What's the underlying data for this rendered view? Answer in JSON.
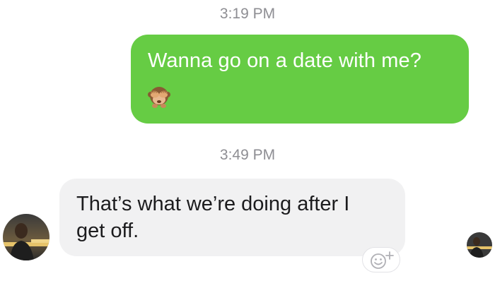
{
  "thread": {
    "timestamp_1": "3:19 PM",
    "timestamp_2": "3:49 PM"
  },
  "messages": [
    {
      "direction": "outgoing",
      "text": "Wanna go on a date with me?",
      "emoji": "see-no-evil-monkey-icon",
      "bubble_color": "#66cc44"
    },
    {
      "direction": "incoming",
      "text_line1": "That’s what we’re doing after I",
      "text_line2": "get off.",
      "bubble_color": "#f1f1f2"
    }
  ],
  "icons": {
    "reaction": "add-reaction-icon",
    "avatar_left": "contact-avatar",
    "avatar_right": "read-receipt-avatar"
  }
}
